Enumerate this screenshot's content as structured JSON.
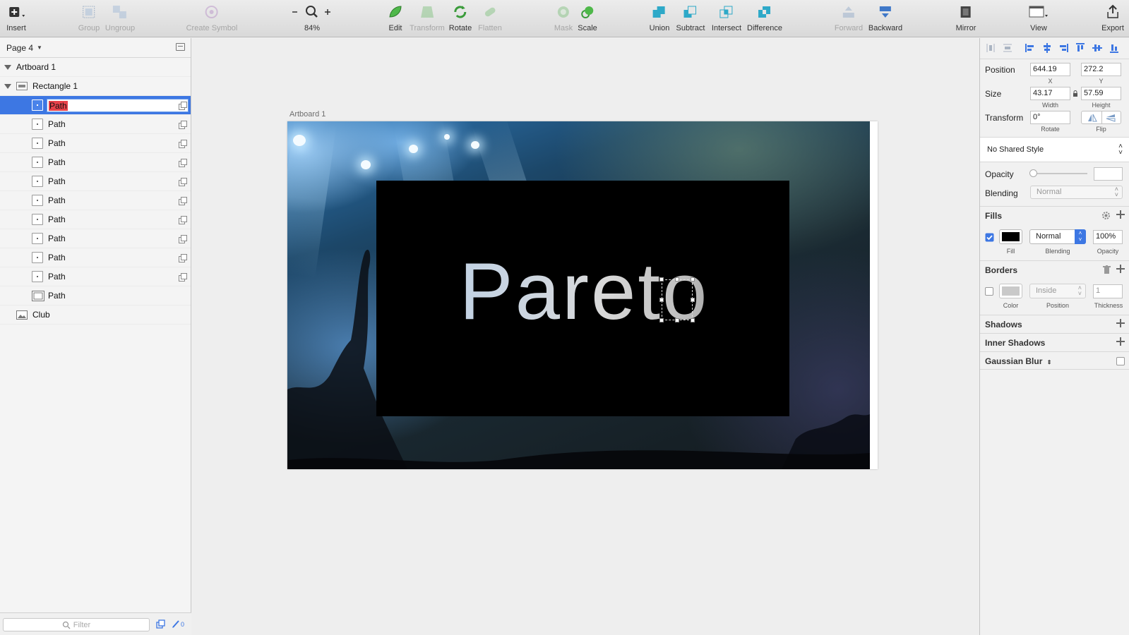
{
  "toolbar": {
    "insert": "Insert",
    "group": "Group",
    "ungroup": "Ungroup",
    "create_symbol": "Create Symbol",
    "zoom_level": "84%",
    "edit": "Edit",
    "transform": "Transform",
    "rotate": "Rotate",
    "flatten": "Flatten",
    "mask": "Mask",
    "scale": "Scale",
    "union": "Union",
    "subtract": "Subtract",
    "intersect": "Intersect",
    "difference": "Difference",
    "forward": "Forward",
    "backward": "Backward",
    "mirror": "Mirror",
    "view": "View",
    "export": "Export"
  },
  "layers": {
    "page_name": "Page 4",
    "artboard": "Artboard 1",
    "group": "Rectangle 1",
    "editing_value": "Path",
    "paths": [
      "Path",
      "Path",
      "Path",
      "Path",
      "Path",
      "Path",
      "Path",
      "Path",
      "Path"
    ],
    "last_path": "Path",
    "image_layer": "Club",
    "filter_placeholder": "Filter",
    "slice_count": "0"
  },
  "canvas": {
    "artboard_label": "Artboard 1",
    "text": "Pareto"
  },
  "inspector": {
    "position_label": "Position",
    "x_value": "644.19",
    "x_label": "X",
    "y_value": "272.2",
    "y_label": "Y",
    "size_label": "Size",
    "width_value": "43.17",
    "width_label": "Width",
    "height_value": "57.59",
    "height_label": "Height",
    "transform_label": "Transform",
    "rotate_value": "0°",
    "rotate_label": "Rotate",
    "flip_label": "Flip",
    "shared_style": "No Shared Style",
    "opacity_label": "Opacity",
    "blending_label": "Blending",
    "blending_value": "Normal",
    "fills_title": "Fills",
    "fill_blending": "Normal",
    "fill_opacity": "100%",
    "fill_label": "Fill",
    "fill_blending_label": "Blending",
    "fill_opacity_label": "Opacity",
    "fill_color": "#000000",
    "borders_title": "Borders",
    "border_position": "Inside",
    "border_thickness": "1",
    "border_color_label": "Color",
    "border_position_label": "Position",
    "border_thickness_label": "Thickness",
    "shadows_title": "Shadows",
    "inner_shadows_title": "Inner Shadows",
    "gaussian_blur_title": "Gaussian Blur"
  },
  "colors": {
    "selection": "#3d77e3",
    "annotation_arrow": "#e8141b"
  }
}
